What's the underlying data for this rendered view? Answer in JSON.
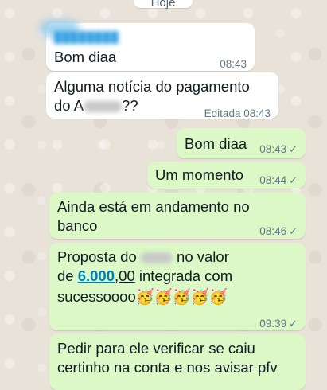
{
  "chat": {
    "date_label": "Hoje",
    "messages": [
      {
        "direction": "incoming",
        "sender": "",
        "text": "Bom diaa",
        "time": "08:43"
      },
      {
        "direction": "incoming",
        "text_line1": "Alguma notícia do pagamento",
        "text_line2_prefix": "do A",
        "text_line2_suffix": "??",
        "edited_time": "Editada 08:43"
      },
      {
        "direction": "outgoing",
        "text": "Bom diaa",
        "time": "08:43",
        "status": "read"
      },
      {
        "direction": "outgoing",
        "text": "Um momento",
        "time": "08:44",
        "status": "read"
      },
      {
        "direction": "outgoing",
        "text_line1": "Ainda está em andamento no",
        "text_line2": "banco",
        "time": "08:46",
        "status": "read"
      },
      {
        "direction": "outgoing",
        "line1_prefix": "Proposta do",
        "line1_suffix": "no valor",
        "line2_prefix": "de",
        "amount_main": "6.000",
        "amount_sep": ",",
        "amount_cents": "00",
        "line2_suffix": "integrada com",
        "line3_text": "sucessoooo",
        "emojis": "🥳🥳🥳🥳🥳",
        "time": "09:39",
        "status": "read"
      },
      {
        "direction": "outgoing",
        "text_line1": "Pedir para ele verificar se caiu",
        "text_line2": "certinho na conta e nos avisar pfv"
      }
    ],
    "status_icon": "✓"
  },
  "colors": {
    "wallpaper": "#e9e2d9",
    "incoming_bubble": "#ffffff",
    "outgoing_bubble": "#dbf8c6",
    "link": "#027eb5"
  }
}
